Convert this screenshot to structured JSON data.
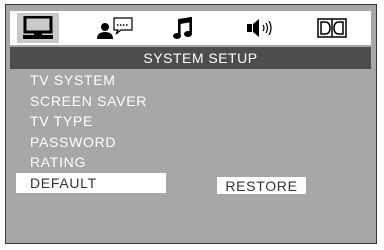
{
  "title": "SYSTEM SETUP",
  "tabs": [
    {
      "icon": "monitor-icon",
      "selected": true
    },
    {
      "icon": "person-speech-icon",
      "selected": false
    },
    {
      "icon": "music-note-icon",
      "selected": false
    },
    {
      "icon": "speaker-icon",
      "selected": false
    },
    {
      "icon": "dolby-digital-icon",
      "selected": false
    }
  ],
  "menu": {
    "items": [
      {
        "label": "TV SYSTEM"
      },
      {
        "label": "SCREEN SAVER"
      },
      {
        "label": "TV TYPE"
      },
      {
        "label": "PASSWORD"
      },
      {
        "label": "RATING"
      },
      {
        "label": "DEFAULT",
        "active": true
      }
    ]
  },
  "option": {
    "label": "RESTORE"
  }
}
